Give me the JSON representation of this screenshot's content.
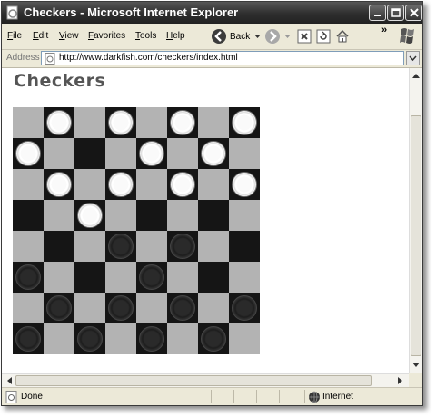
{
  "window": {
    "title": "Checkers - Microsoft Internet Explorer"
  },
  "menu": {
    "items": [
      {
        "label": "File",
        "ul": "F",
        "rest": "ile"
      },
      {
        "label": "Edit",
        "ul": "E",
        "rest": "dit"
      },
      {
        "label": "View",
        "ul": "V",
        "rest": "iew"
      },
      {
        "label": "Favorites",
        "ul": "F",
        "rest": "avorites",
        "pre": ""
      },
      {
        "label": "Tools",
        "ul": "T",
        "rest": "ools"
      },
      {
        "label": "Help",
        "ul": "H",
        "rest": "elp"
      }
    ],
    "back_label": "Back",
    "chevron": "»"
  },
  "address": {
    "label": "Address",
    "url": "http://www.darkfish.com/checkers/index.html"
  },
  "page": {
    "title": "Checkers"
  },
  "board": {
    "rows": [
      [
        ".",
        "w",
        ".",
        "w",
        ".",
        "w",
        ".",
        "w"
      ],
      [
        "w",
        ".",
        ".",
        ".",
        "w",
        ".",
        "w",
        "."
      ],
      [
        ".",
        "w",
        ".",
        "w",
        ".",
        "w",
        ".",
        "w"
      ],
      [
        ".",
        ".",
        "w",
        ".",
        ".",
        ".",
        ".",
        "."
      ],
      [
        ".",
        ".",
        ".",
        "b",
        ".",
        "b",
        ".",
        "."
      ],
      [
        "b",
        ".",
        ".",
        ".",
        "b",
        ".",
        ".",
        "."
      ],
      [
        ".",
        "b",
        ".",
        "b",
        ".",
        "b",
        ".",
        "b"
      ],
      [
        "b",
        ".",
        "b",
        ".",
        "b",
        ".",
        "b",
        "."
      ]
    ],
    "light_color": "#b3b3b3",
    "dark_color": "#151515"
  },
  "status": {
    "text": "Done",
    "zone": "Internet"
  }
}
